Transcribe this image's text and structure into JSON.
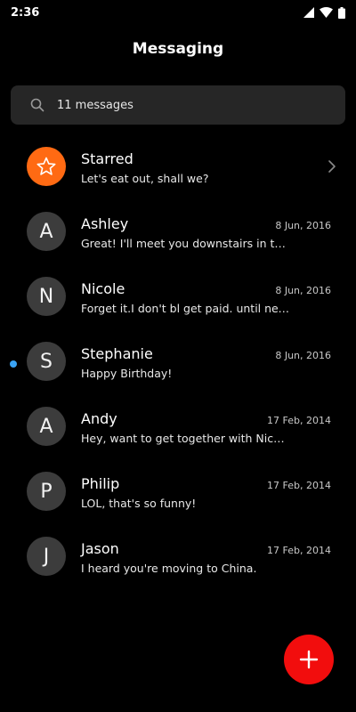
{
  "status_bar": {
    "time": "2:36",
    "icons": [
      "signal-icon",
      "wifi-icon",
      "battery-icon"
    ]
  },
  "header": {
    "title": "Messaging"
  },
  "search": {
    "icon": "search-icon",
    "text": "11 messages"
  },
  "conversations": [
    {
      "avatar": "star-icon",
      "name": "Starred",
      "date": "",
      "preview": "Let's eat out, shall we?",
      "starred": true,
      "unread": false
    },
    {
      "avatar": "A",
      "name": "Ashley",
      "date": "8 Jun, 2016",
      "preview": "Great! I'll meet you downstairs in ten minutes",
      "starred": false,
      "unread": false
    },
    {
      "avatar": "N",
      "name": "Nicole",
      "date": "8 Jun, 2016",
      "preview": "Forget it.I don't bl get paid. until next Friday",
      "starred": false,
      "unread": false
    },
    {
      "avatar": "S",
      "name": "Stephanie",
      "date": "8 Jun, 2016",
      "preview": "Happy Birthday!",
      "starred": false,
      "unread": true
    },
    {
      "avatar": "A",
      "name": "Andy",
      "date": "17 Feb, 2014",
      "preview": "Hey, want to get together with Nicole tonight?",
      "starred": false,
      "unread": false
    },
    {
      "avatar": "P",
      "name": "Philip",
      "date": "17 Feb, 2014",
      "preview": "LOL, that's so funny!",
      "starred": false,
      "unread": false
    },
    {
      "avatar": "J",
      "name": "Jason",
      "date": "17 Feb, 2014",
      "preview": "I heard you're moving to China.",
      "starred": false,
      "unread": false
    }
  ],
  "fab": {
    "icon": "plus-icon"
  },
  "colors": {
    "background": "#000000",
    "search_bg": "#262626",
    "avatar_bg": "#3c3c3c",
    "starred_accent": "#ff6a13",
    "unread_dot": "#3aa3f5",
    "fab": "#f20d0d"
  }
}
